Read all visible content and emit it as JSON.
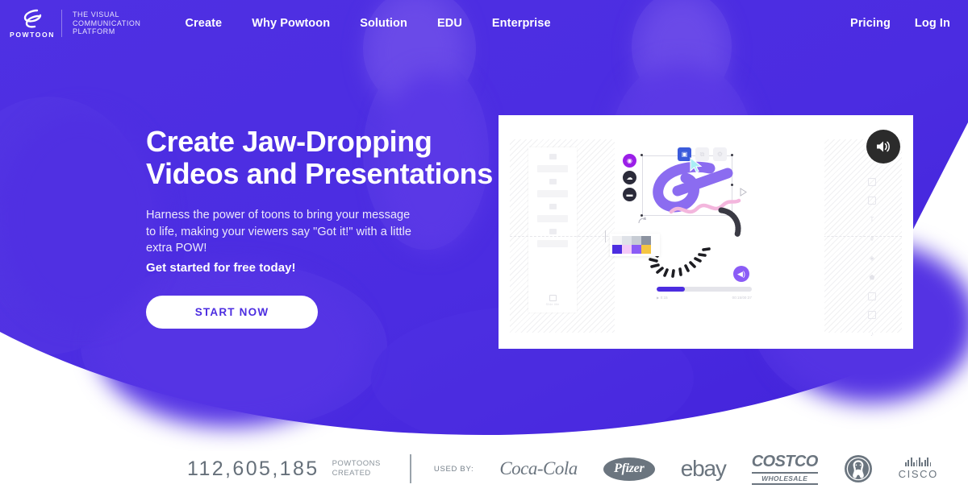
{
  "brand": {
    "name": "POWTOON",
    "tagline": "THE VISUAL\nCOMMUNICATION\nPLATFORM",
    "tagline_l1": "THE VISUAL",
    "tagline_l2": "COMMUNICATION",
    "tagline_l3": "PLATFORM",
    "logo_icon": "powtoon-swoosh-logo-icon"
  },
  "colors": {
    "hero_purple": "#4c2de0",
    "hero_purple_dark": "#3d1fd1",
    "cta_text": "#4c2de0",
    "accent_violet": "#8b5cf6",
    "accent_magenta": "#9b1fe8",
    "sound_button": "#2b2b2b",
    "footer_gray": "#6b757f"
  },
  "header": {
    "nav": [
      {
        "label": "Create",
        "name": "nav-create"
      },
      {
        "label": "Why Powtoon",
        "name": "nav-why-powtoon"
      },
      {
        "label": "Solution",
        "name": "nav-solution"
      },
      {
        "label": "EDU",
        "name": "nav-edu"
      },
      {
        "label": "Enterprise",
        "name": "nav-enterprise"
      }
    ],
    "right": [
      {
        "label": "Pricing",
        "name": "nav-pricing"
      },
      {
        "label": "Log In",
        "name": "nav-login"
      }
    ]
  },
  "hero": {
    "title_line1": "Create Jaw-Dropping",
    "title_line2": "Videos and Presentations",
    "sub_line1": "Harness the power of toons to bring your message",
    "sub_line2": "to life, making your viewers say \"Got it!\" with a little",
    "sub_line3": "extra POW!",
    "sub_strong": "Get started for free today!",
    "cta_label": "START NOW"
  },
  "mockup": {
    "sound_icon": "speaker-volume-icon",
    "left_panel_label": "Slide title",
    "progress_percent": 30,
    "play_time": "0:15",
    "total_time": "00:15/00:37",
    "palette_top": [
      "#f2f2f4",
      "#dfe2e8",
      "#c7ccd4",
      "#8c93a0"
    ],
    "palette_bottom": [
      "#4c2de0",
      "#f3c9f7",
      "#8b5cf6",
      "#f5c542"
    ],
    "tools": [
      {
        "name": "tool-slides-icon",
        "glyph": "▣"
      },
      {
        "name": "tool-background-icon",
        "glyph": "▢"
      },
      {
        "name": "tool-text-icon",
        "glyph": "T"
      },
      {
        "name": "tool-character-icon",
        "glyph": "⚹"
      },
      {
        "name": "tool-props-icon",
        "glyph": "◈"
      },
      {
        "name": "tool-shapes-icon",
        "glyph": "⬟"
      },
      {
        "name": "tool-image-icon",
        "glyph": "▦"
      },
      {
        "name": "tool-video-icon",
        "glyph": "▷"
      },
      {
        "name": "tool-music-icon",
        "glyph": "♪"
      }
    ],
    "side_controls": [
      {
        "name": "control-effects-icon",
        "glyph": "◉"
      },
      {
        "name": "control-cloud-icon",
        "glyph": "☁"
      },
      {
        "name": "control-lock-icon",
        "glyph": "▬"
      }
    ],
    "top_chips": [
      {
        "name": "chip-copy-icon",
        "glyph": "▣",
        "active": true
      },
      {
        "name": "chip-duplicate-icon",
        "glyph": "⧉",
        "active": false
      },
      {
        "name": "chip-settings-icon",
        "glyph": "⚙",
        "active": false
      }
    ]
  },
  "footer": {
    "count": "112,605,185",
    "count_label_l1": "POWTOONS",
    "count_label_l2": "CREATED",
    "used_by": "USED BY:",
    "logos": [
      {
        "name": "logo-coca-cola",
        "label": "Coca-Cola"
      },
      {
        "name": "logo-pfizer",
        "label": "Pfizer"
      },
      {
        "name": "logo-ebay",
        "label": "ebay"
      },
      {
        "name": "logo-costco",
        "label": "COSTCO",
        "sub": "WHOLESALE"
      },
      {
        "name": "logo-starbucks",
        "label": "Starbucks"
      },
      {
        "name": "logo-cisco",
        "label": "CISCO"
      }
    ]
  }
}
